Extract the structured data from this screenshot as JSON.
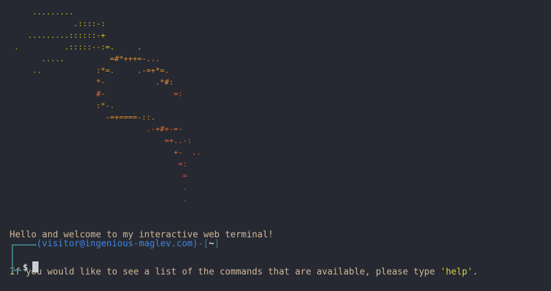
{
  "ascii_art": [
    [
      {
        "t": "     .........",
        "c": "c-y"
      }
    ],
    [
      {
        "t": "              .::::-:",
        "c": "c-y"
      }
    ],
    [
      {
        "t": "    .........::::::-+",
        "c": "c-y"
      }
    ],
    [
      {
        "t": " .",
        "c": "c-g"
      },
      {
        "t": "          .:::::--:=.     .",
        "c": "c-y"
      }
    ],
    [
      {
        "t": "       .....",
        "c": "c-yg"
      },
      {
        "t": "          =#*+++=-...",
        "c": "c-o"
      }
    ],
    [
      {
        "t": "     ..",
        "c": "c-g"
      },
      {
        "t": "            :*=.     .-=+*=.",
        "c": "c-o"
      }
    ],
    [
      {
        "t": "                   *-           .*#:",
        "c": "c-o"
      }
    ],
    [
      {
        "t": "                   #-               =:",
        "c": "c-o2"
      }
    ],
    [
      {
        "t": "                   :*-.",
        "c": "c-o"
      }
    ],
    [
      {
        "t": "                     -=+====-::.",
        "c": "c-o"
      }
    ],
    [
      {
        "t": "                              .-+#+-=-",
        "c": "c-o2"
      }
    ],
    [
      {
        "t": "                                  =+..-:",
        "c": "c-o2"
      }
    ],
    [
      {
        "t": "                                    +-  ..",
        "c": "c-o2"
      }
    ],
    [
      {
        "t": "                                     =:",
        "c": "c-r"
      }
    ],
    [
      {
        "t": "                                      =",
        "c": "c-r"
      }
    ],
    [
      {
        "t": "                                      .",
        "c": "c-r"
      }
    ],
    [
      {
        "t": "                                      .",
        "c": "c-r"
      }
    ]
  ],
  "welcome": {
    "line1": "Hello and welcome to my interactive web terminal!",
    "line2_before": "If you would like to see a list of the commands that are available, please type ",
    "line2_command": "'help'",
    "line2_after": "."
  },
  "prompt": {
    "user_host": "(visitor@ingenious-maglev.com)",
    "separator": "-[",
    "directory": "~",
    "close_bracket": "]",
    "symbol": "$",
    "input_value": ""
  },
  "colors": {
    "background": "#262931",
    "text": "#d2b79a",
    "highlight": "#e0cd47",
    "user_host": "#3d86e6",
    "frame": "#3f7c83"
  }
}
